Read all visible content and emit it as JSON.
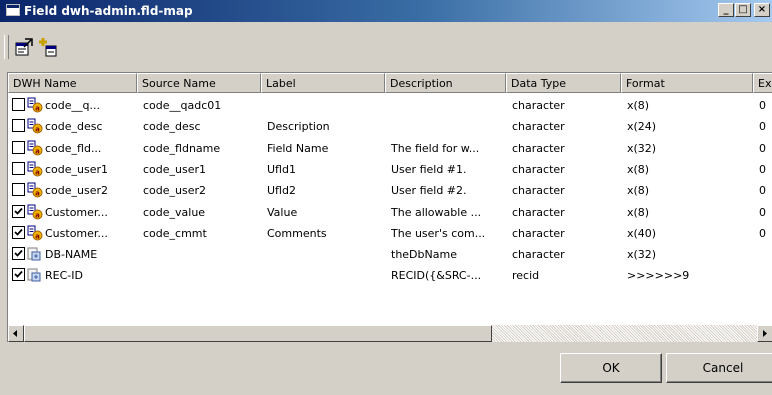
{
  "window": {
    "title": "Field dwh-admin.fld-map",
    "minimize_label": "_",
    "maximize_label": "□",
    "close_label": "×"
  },
  "columns": [
    "DWH Name",
    "Source Name",
    "Label",
    "Description",
    "Data Type",
    "Format",
    "Ex"
  ],
  "rows": [
    {
      "checked": false,
      "icon": "field-icon",
      "dwh_name": "code__q...",
      "source_name": "code__qadc01",
      "label": "",
      "description": "",
      "data_type": "character",
      "format": "x(8)",
      "extent": "0"
    },
    {
      "checked": false,
      "icon": "field-icon",
      "dwh_name": "code_desc",
      "source_name": "code_desc",
      "label": "Description",
      "description": "",
      "data_type": "character",
      "format": "x(24)",
      "extent": "0"
    },
    {
      "checked": false,
      "icon": "field-icon",
      "dwh_name": "code_fld...",
      "source_name": "code_fldname",
      "label": "Field Name",
      "description": "The field for w...",
      "data_type": "character",
      "format": "x(32)",
      "extent": "0"
    },
    {
      "checked": false,
      "icon": "field-icon",
      "dwh_name": "code_user1",
      "source_name": "code_user1",
      "label": "Ufld1",
      "description": "User field #1.",
      "data_type": "character",
      "format": "x(8)",
      "extent": "0"
    },
    {
      "checked": false,
      "icon": "field-icon",
      "dwh_name": "code_user2",
      "source_name": "code_user2",
      "label": "Ufld2",
      "description": "User field #2.",
      "data_type": "character",
      "format": "x(8)",
      "extent": "0"
    },
    {
      "checked": true,
      "icon": "field-icon",
      "dwh_name": "Customer...",
      "source_name": "code_value",
      "label": "Value",
      "description": "The allowable ...",
      "data_type": "character",
      "format": "x(8)",
      "extent": "0"
    },
    {
      "checked": true,
      "icon": "field-icon",
      "dwh_name": "Customer...",
      "source_name": "code_cmmt",
      "label": "Comments",
      "description": "The user's com...",
      "data_type": "character",
      "format": "x(40)",
      "extent": "0"
    },
    {
      "checked": true,
      "icon": "computed-icon",
      "dwh_name": "DB-NAME",
      "source_name": "",
      "label": "",
      "description": "theDbName",
      "data_type": "character",
      "format": "x(32)",
      "extent": ""
    },
    {
      "checked": true,
      "icon": "computed-icon",
      "dwh_name": "REC-ID",
      "source_name": "",
      "label": "",
      "description": "RECID({&SRC-...",
      "data_type": "recid",
      "format": ">>>>>>9",
      "extent": ""
    }
  ],
  "buttons": {
    "ok": "OK",
    "cancel": "Cancel"
  },
  "toolbar": {
    "icons": [
      "properties-icon",
      "add-field-icon"
    ]
  }
}
